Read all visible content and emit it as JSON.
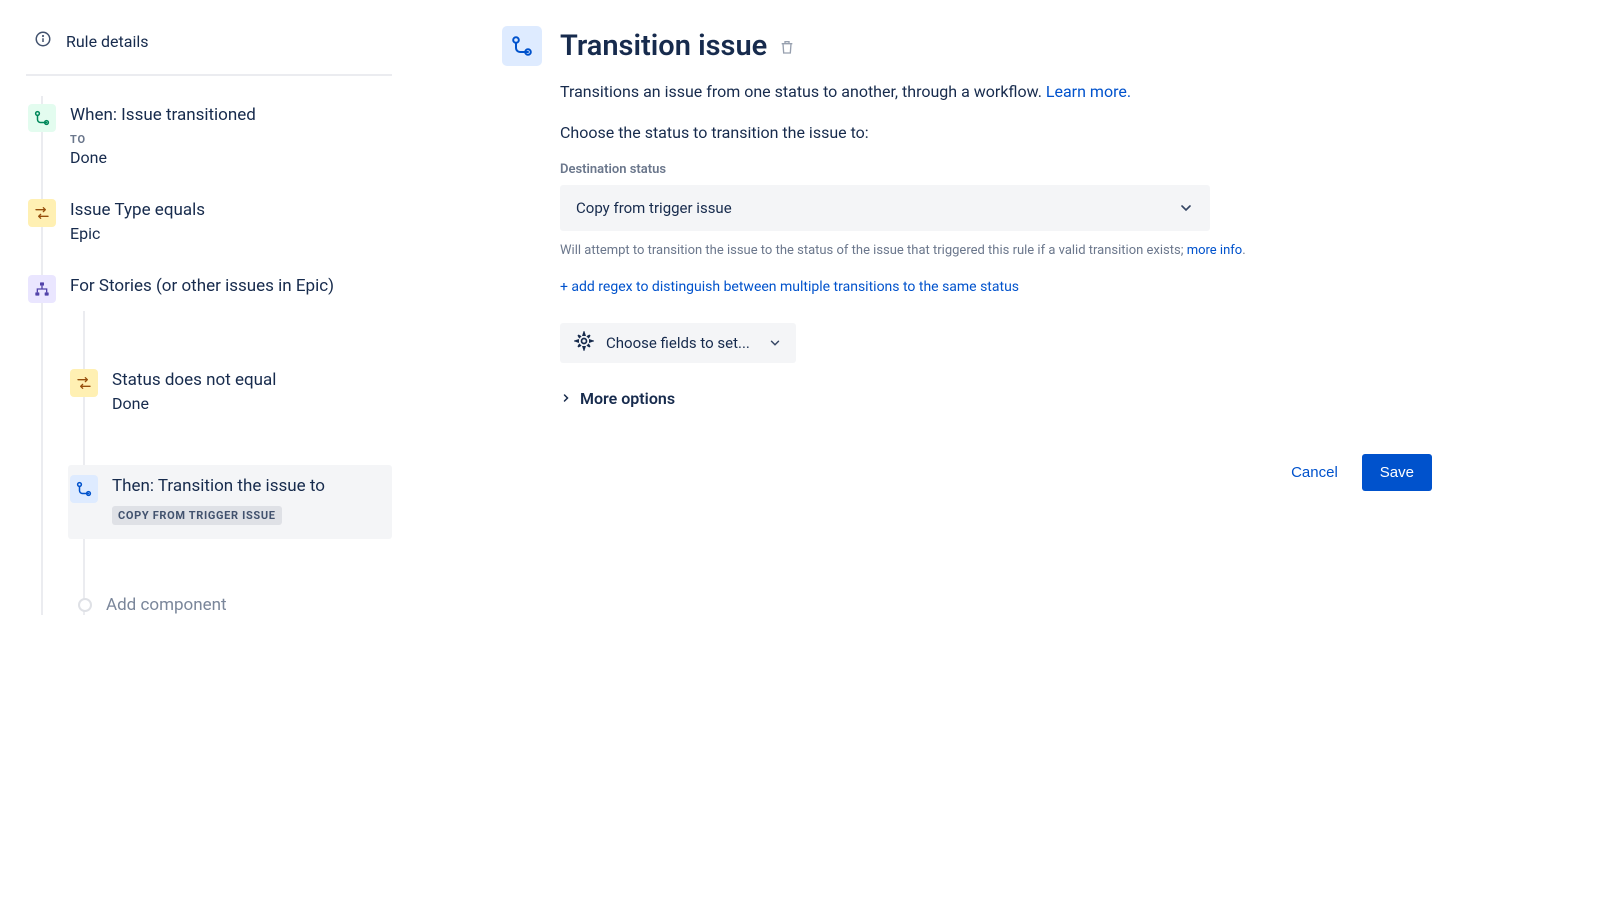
{
  "sidebar": {
    "ruleDetailsLabel": "Rule details",
    "steps": {
      "trigger": {
        "title": "When: Issue transitioned",
        "subLabel": "TO",
        "value": "Done"
      },
      "cond1": {
        "title": "Issue Type equals",
        "value": "Epic"
      },
      "branch": {
        "title": "For Stories (or other issues in Epic)"
      },
      "childCond": {
        "title": "Status does not equal",
        "value": "Done"
      },
      "action": {
        "title": "Then: Transition the issue to",
        "badge": "COPY FROM TRIGGER ISSUE"
      }
    },
    "addComponentLabel": "Add component"
  },
  "main": {
    "title": "Transition issue",
    "description": "Transitions an issue from one status to another, through a workflow. ",
    "learnMore": "Learn more.",
    "chooseLabel": "Choose the status to transition the issue to:",
    "destLabel": "Destination status",
    "destValue": "Copy from trigger issue",
    "hint": "Will attempt to transition the issue to the status of the issue that triggered this rule if a valid transition exists; ",
    "moreInfo": "more info",
    "addRegex": "+ add regex to distinguish between multiple transitions to the same status",
    "chooseFields": "Choose fields to set...",
    "moreOptions": "More options",
    "cancel": "Cancel",
    "save": "Save"
  }
}
